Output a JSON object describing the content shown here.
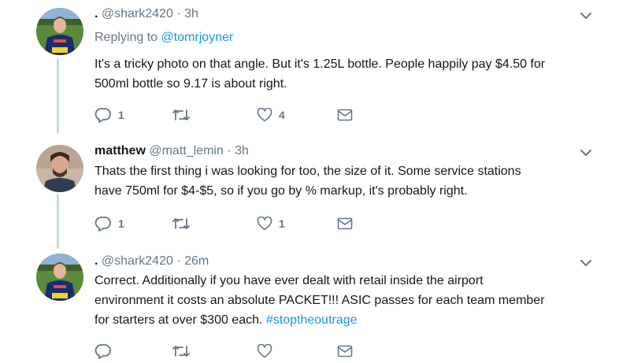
{
  "tweets": [
    {
      "name": ".",
      "handle": "@shark2420",
      "time": "3h",
      "replying_prefix": "Replying to ",
      "replying_to": "@tomrjoyner",
      "text_lines": [
        "It's a tricky photo on that angle. But it's 1.25L bottle. People happily pay $4.50 for",
        "500ml bottle so 9.17 is about right."
      ],
      "reply_count": "1",
      "retweet_count": "",
      "like_count": "4"
    },
    {
      "name": "matthew",
      "handle": "@matt_lemin",
      "time": "3h",
      "text_lines": [
        "Thats the first thing i was looking for too, the size of it. Some service stations",
        "have 750ml for $4-$5, so if you go by % markup, it's probably right."
      ],
      "reply_count": "1",
      "retweet_count": "",
      "like_count": "1"
    },
    {
      "name": ".",
      "handle": "@shark2420",
      "time": "26m",
      "text_lines": [
        "Correct. Additionally if you have ever dealt with retail inside the airport",
        "environment it costs an absolute PACKET!!! ASIC passes for each team member"
      ],
      "text_last_prefix": "for starters at over $300 each. ",
      "hashtag": "#stoptheoutrage",
      "reply_count": "",
      "retweet_count": "",
      "like_count": ""
    }
  ],
  "separator": "·",
  "icons": {
    "caret": "chevron-down-icon",
    "reply": "reply-icon",
    "retweet": "retweet-icon",
    "like": "heart-icon",
    "dm": "envelope-icon"
  },
  "colors": {
    "link": "#1b95e0",
    "secondary": "#657786",
    "thread_line": "#c4dbec"
  }
}
